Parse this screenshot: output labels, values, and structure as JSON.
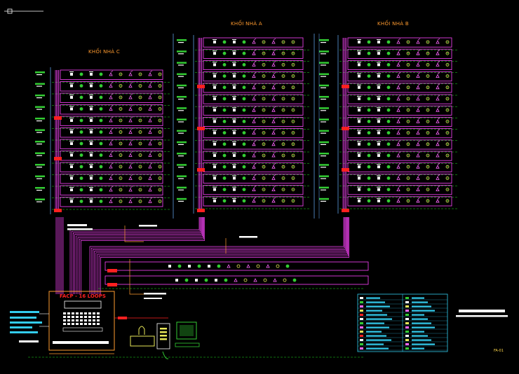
{
  "drawing": {
    "blocks": [
      {
        "id": "c",
        "label": "KHỐI NHÀ C"
      },
      {
        "id": "a",
        "label": "KHỐI NHÀ A"
      },
      {
        "id": "b",
        "label": "KHỐI NHÀ B"
      }
    ],
    "control_panel_title": "FACP - 16 LOOPS",
    "sheet_number": "FA-01"
  },
  "colors": {
    "background": "#000000",
    "bus": "#ff44ff",
    "riser": "#6ab0ff",
    "branch": "#ff9b2f",
    "dashed": "#22dd22",
    "device_green": "#33cc33",
    "device_white": "#ffffff",
    "device_red": "#ff2020",
    "device_magenta": "#ff66ff",
    "device_yellow": "#e8e858",
    "legend_cyan": "#33ccee"
  }
}
